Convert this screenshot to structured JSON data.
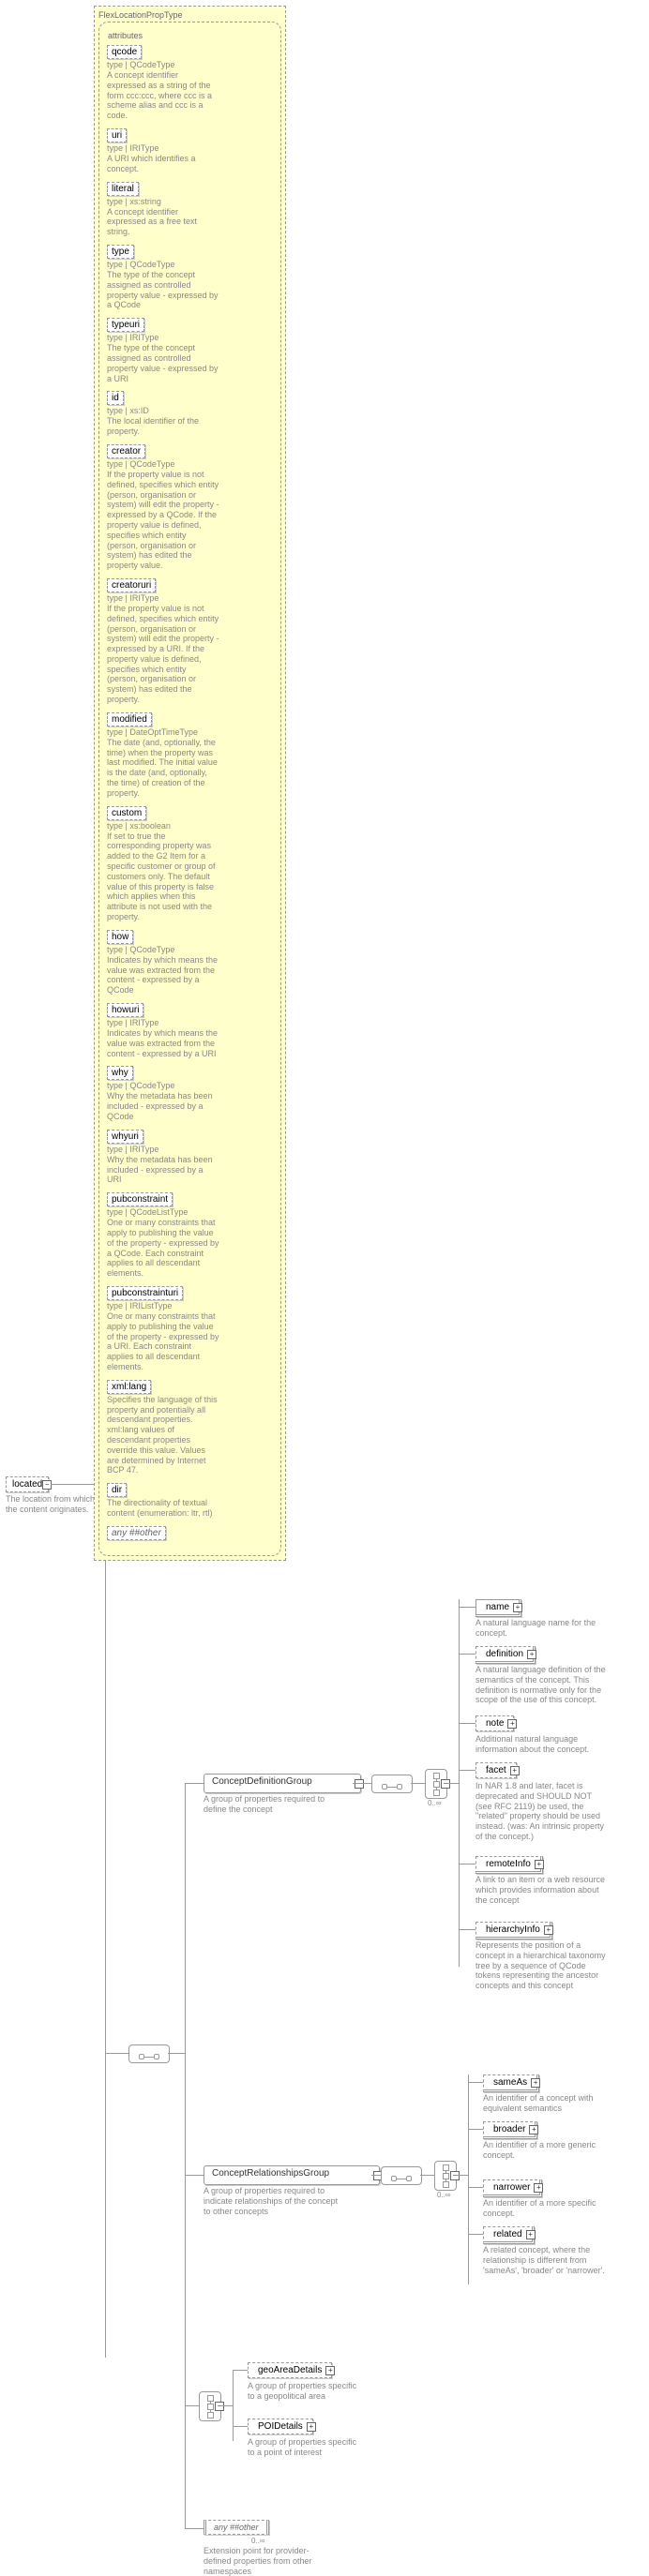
{
  "root": {
    "label": "located",
    "desc": "The location from which the content originates."
  },
  "outer": {
    "title": "FlexLocationPropType",
    "attrTitle": "attributes"
  },
  "attrs": [
    {
      "name": "qcode",
      "at": "type | QCodeType",
      "desc": "A concept identifier expressed as a string of the form ccc:ccc, where ccc is a scheme alias and ccc is a code."
    },
    {
      "name": "uri",
      "at": "type | IRIType",
      "desc": "A URI which identifies a concept."
    },
    {
      "name": "literal",
      "at": "type | xs:string",
      "desc": "A concept identifier expressed as a free text string."
    },
    {
      "name": "type",
      "at": "type | QCodeType",
      "desc": "The type of the concept assigned as controlled property value - expressed by a QCode"
    },
    {
      "name": "typeuri",
      "at": "type | IRIType",
      "desc": "The type of the concept assigned as controlled property value - expressed by a URI"
    },
    {
      "name": "id",
      "at": "type | xs:ID",
      "desc": "The local identifier of the property."
    },
    {
      "name": "creator",
      "at": "type | QCodeType",
      "desc": "If the property value is not defined, specifies which entity (person, organisation or system) will edit the property - expressed by a QCode. If the property value is defined, specifies which entity (person, organisation or system) has edited the property value."
    },
    {
      "name": "creatoruri",
      "at": "type | IRIType",
      "desc": "If the property value is not defined, specifies which entity (person, organisation or system) will edit the property - expressed by a URI. If the property value is defined, specifies which entity (person, organisation or system) has edited the property."
    },
    {
      "name": "modified",
      "at": "type | DateOptTimeType",
      "desc": "The date (and, optionally, the time) when the property was last modified. The initial value is the date (and, optionally, the time) of creation of the property."
    },
    {
      "name": "custom",
      "at": "type | xs:boolean",
      "desc": "If set to true the corresponding property was added to the G2 Item for a specific customer or group of customers only. The default value of this property is false which applies when this attribute is not used with the property."
    },
    {
      "name": "how",
      "at": "type | QCodeType",
      "desc": "Indicates by which means the value was extracted from the content - expressed by a QCode"
    },
    {
      "name": "howuri",
      "at": "type | IRIType",
      "desc": "Indicates by which means the value was extracted from the content - expressed by a URI"
    },
    {
      "name": "why",
      "at": "type | QCodeType",
      "desc": "Why the metadata has been included - expressed by a QCode"
    },
    {
      "name": "whyuri",
      "at": "type | IRIType",
      "desc": "Why the metadata has been included - expressed by a URI"
    },
    {
      "name": "pubconstraint",
      "at": "type | QCodeListType",
      "desc": "One or many constraints that apply to publishing the value of the property - expressed by a QCode. Each constraint applies to all descendant elements."
    },
    {
      "name": "pubconstrainturi",
      "at": "type | IRIListType",
      "desc": "One or many constraints that apply to publishing the value of the property - expressed by a URI. Each constraint applies to all descendant elements."
    },
    {
      "name": "xml:lang",
      "at": "",
      "desc": "Specifies the language of this property and potentially all descendant properties. xml:lang values of descendant properties override this value. Values are determined by Internet BCP 47."
    },
    {
      "name": "dir",
      "at": "",
      "desc": "The directionality of textual content (enumeration: ltr, rtl)"
    }
  ],
  "anyOther": "any ##other",
  "groups": {
    "cdef": {
      "label": "ConceptDefinitionGroup",
      "desc": "A group of properties required to define the concept"
    },
    "crel": {
      "label": "ConceptRelationshipsGroup",
      "desc": "A group of properties required to indicate relationships of the concept to other concepts"
    }
  },
  "cdefItems": [
    {
      "name": "name",
      "desc": "A natural language name for the concept."
    },
    {
      "name": "definition",
      "desc": "A natural language definition of the semantics of the concept. This definition is normative only for the scope of the use of this concept."
    },
    {
      "name": "note",
      "desc": "Additional natural language information about the concept."
    },
    {
      "name": "facet",
      "desc": "In NAR 1.8 and later, facet is deprecated and SHOULD NOT (see RFC 2119) be used, the \"related\" property should be used instead. (was: An intrinsic property of the concept.)"
    },
    {
      "name": "remoteInfo",
      "desc": "A link to an item or a web resource which provides information about the concept"
    },
    {
      "name": "hierarchyInfo",
      "desc": "Represents the position of a concept in a hierarchical taxonomy tree by a sequence of QCode tokens representing the ancestor concepts and this concept"
    }
  ],
  "crelItems": [
    {
      "name": "sameAs",
      "desc": "An identifier of a concept with equivalent semantics"
    },
    {
      "name": "broader",
      "desc": "An identifier of a more generic concept."
    },
    {
      "name": "narrower",
      "desc": "An identifier of a more specific concept."
    },
    {
      "name": "related",
      "desc": "A related concept, where the relationship is different from 'sameAs', 'broader' or 'narrower'."
    }
  ],
  "details": [
    {
      "name": "geoAreaDetails",
      "desc": "A group of properties specific to a geopolitical area"
    },
    {
      "name": "POIDetails",
      "desc": "A group of properties specific to a point of interest"
    }
  ],
  "bottomAny": {
    "label": "any ##other",
    "mult": "0..∞",
    "desc": "Extension point for provider-defined properties from other namespaces"
  },
  "mult": "0..∞"
}
